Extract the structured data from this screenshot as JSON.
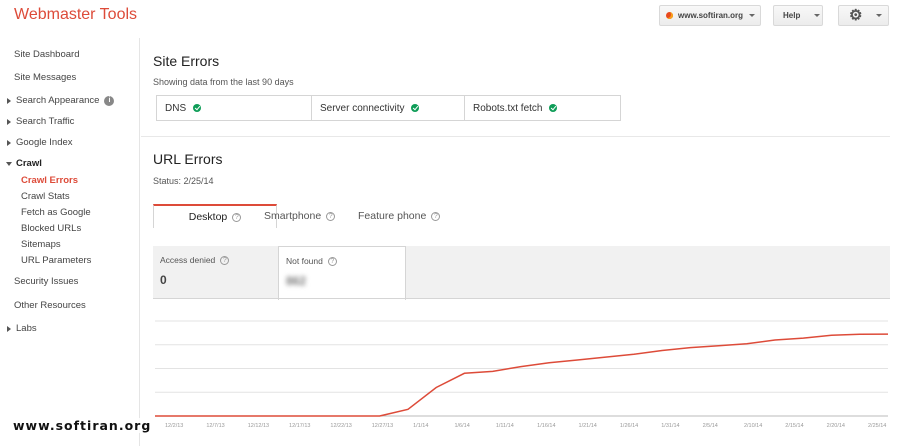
{
  "header": {
    "app_title": "Webmaster Tools",
    "site_selector": "www.softiran.org",
    "help_label": "Help",
    "settings_icon": "gear-icon"
  },
  "sidebar": {
    "items": [
      {
        "label": "Site Dashboard"
      },
      {
        "label": "Site Messages"
      },
      {
        "label": "Search Appearance"
      },
      {
        "label": "Search Traffic"
      },
      {
        "label": "Google Index"
      },
      {
        "label": "Crawl"
      },
      {
        "label": "Security Issues"
      },
      {
        "label": "Other Resources"
      },
      {
        "label": "Labs"
      }
    ],
    "crawl_subitems": [
      {
        "label": "Crawl Errors"
      },
      {
        "label": "Crawl Stats"
      },
      {
        "label": "Fetch as Google"
      },
      {
        "label": "Blocked URLs"
      },
      {
        "label": "Sitemaps"
      },
      {
        "label": "URL Parameters"
      }
    ]
  },
  "site_errors": {
    "title": "Site Errors",
    "subtitle": "Showing data from the last 90 days",
    "items": [
      {
        "label": "DNS"
      },
      {
        "label": "Server connectivity"
      },
      {
        "label": "Robots.txt fetch"
      }
    ]
  },
  "url_errors": {
    "title": "URL Errors",
    "status": "Status: 2/25/14",
    "tabs": [
      {
        "label": "Desktop"
      },
      {
        "label": "Smartphone"
      },
      {
        "label": "Feature phone"
      }
    ],
    "metrics": [
      {
        "label": "Access denied",
        "value": "0"
      },
      {
        "label": "Not found",
        "value": "862"
      }
    ]
  },
  "chart_data": {
    "type": "line",
    "series_color": "#dd4b39",
    "grid": true,
    "x": [
      "12/2/13",
      "12/7/13",
      "12/12/13",
      "12/17/13",
      "12/22/13",
      "12/27/13",
      "1/1/14",
      "1/6/14",
      "1/11/14",
      "1/16/14",
      "1/21/14",
      "1/26/14",
      "1/31/14",
      "2/5/14",
      "2/10/14",
      "2/15/14",
      "2/20/14",
      "2/25/14"
    ],
    "series": [
      {
        "values": [
          0,
          0,
          0,
          0,
          70,
          300,
          450,
          470,
          520,
          560,
          590,
          620,
          650,
          690,
          720,
          740,
          760,
          800,
          820,
          850,
          860,
          862
        ]
      }
    ]
  },
  "watermark": "www.softiran.org"
}
